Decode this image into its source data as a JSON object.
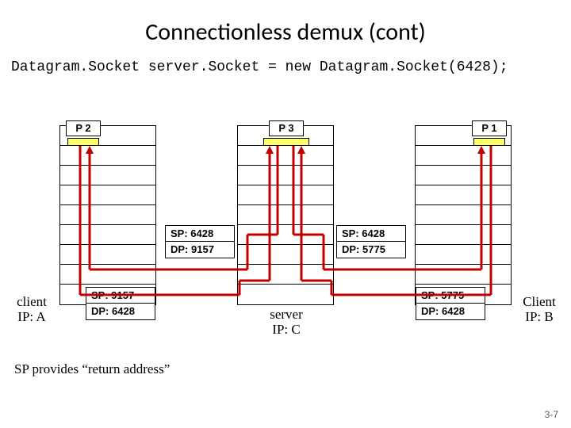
{
  "title": "Connectionless demux (cont)",
  "code_line": "Datagram.Socket server.Socket = new Datagram.Socket(6428);",
  "processes": {
    "p2": "P 2",
    "p3": "P 3",
    "p1": "P 1"
  },
  "pkt_upper_left": {
    "sp": "SP: 6428",
    "dp": "DP: 9157"
  },
  "pkt_upper_right": {
    "sp": "SP: 6428",
    "dp": "DP: 5775"
  },
  "pkt_lower_left": {
    "sp": "SP: 9157",
    "dp": "DP: 6428"
  },
  "pkt_lower_right": {
    "sp": "SP: 5775",
    "dp": "DP: 6428"
  },
  "hosts": {
    "left": {
      "l1": "client",
      "l2": "IP: A"
    },
    "center": {
      "l1": "server",
      "l2": "IP: C"
    },
    "right": {
      "l1": "Client",
      "l2": "IP: B"
    }
  },
  "footnote": "SP provides “return address”",
  "slidenum": "3-7"
}
